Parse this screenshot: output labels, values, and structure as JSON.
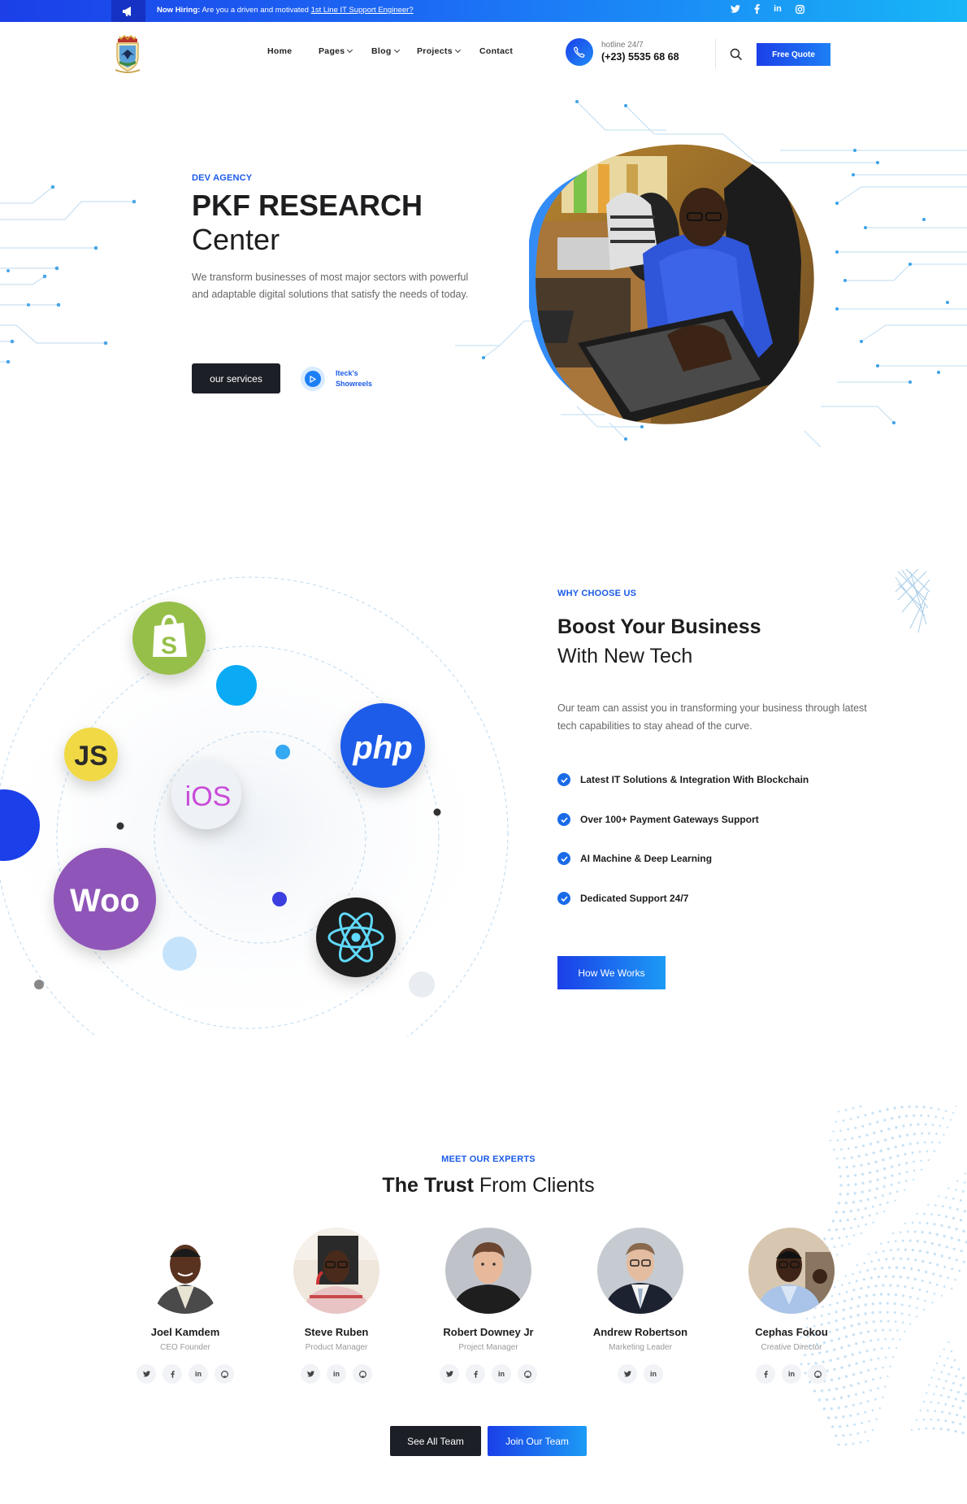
{
  "topbar": {
    "hiring_prefix": "Now Hiring:",
    "hiring_text": "Are you a driven and motivated",
    "hiring_link": "1st Line IT Support Engineer?",
    "megaphone_icon": "megaphone-icon",
    "social": [
      "twitter-icon",
      "facebook-icon",
      "linkedin-icon",
      "instagram-icon"
    ]
  },
  "header": {
    "nav": [
      "Home",
      "Pages",
      "Blog",
      "Projects",
      "Contact"
    ],
    "hotline_label": "hotline 24/7",
    "hotline_number": "(+23) 5535 68 68",
    "quote_button": "Free Quote"
  },
  "hero": {
    "eyebrow": "DEV AGENCY",
    "title_bold": "PKF RESEARCH",
    "title_light": "Center",
    "description": "We transform businesses of most major sectors with powerful and adaptable digital solutions that satisfy the needs of today.",
    "services_button": "our services",
    "showreel_label": "Iteck's Showreels"
  },
  "why": {
    "eyebrow": "WHY CHOOSE US",
    "title_bold": "Boost Your Business",
    "title_light": "With New Tech",
    "description": "Our team can assist you in transforming your business through latest tech capabilities to stay ahead of the curve.",
    "features": [
      "Latest IT Solutions & Integration With Blockchain",
      "Over 100+ Payment Gateways Support",
      "AI Machine & Deep Learning",
      "Dedicated Support 24/7"
    ],
    "button": "How We Works",
    "tech_icons": {
      "shopify": "S",
      "js": "JS",
      "php": "php",
      "ios": "iOS",
      "woo": "Woo",
      "react": "react-icon"
    }
  },
  "team": {
    "eyebrow": "MEET OUR EXPERTS",
    "title_bold": "The Trust",
    "title_light": "From Clients",
    "members": [
      {
        "name": "Joel Kamdem",
        "role": "CEO Founder",
        "socials": [
          "t",
          "f",
          "in",
          "gh"
        ]
      },
      {
        "name": "Steve Ruben",
        "role": "Product Manager",
        "socials": [
          "t",
          "in",
          "gh"
        ]
      },
      {
        "name": "Robert Downey Jr",
        "role": "Project Manager",
        "socials": [
          "t",
          "f",
          "in",
          "gh"
        ]
      },
      {
        "name": "Andrew Robertson",
        "role": "Marketing Leader",
        "socials": [
          "t",
          "in"
        ]
      },
      {
        "name": "Cephas Fokou",
        "role": "Creative Director",
        "socials": [
          "f",
          "in",
          "gh"
        ]
      }
    ],
    "see_all_button": "See All Team",
    "join_button": "Join Our Team"
  },
  "colors": {
    "accent": "#1b3fe8",
    "accent_light": "#1c9bf5",
    "dark": "#1c1f26"
  }
}
